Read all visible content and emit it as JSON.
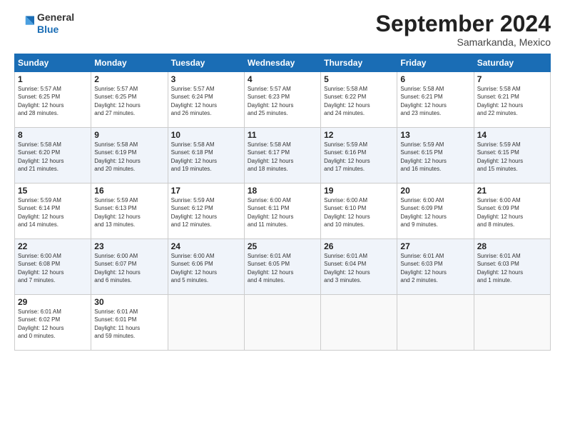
{
  "logo": {
    "line1": "General",
    "line2": "Blue"
  },
  "title": "September 2024",
  "subtitle": "Samarkanda, Mexico",
  "days_header": [
    "Sunday",
    "Monday",
    "Tuesday",
    "Wednesday",
    "Thursday",
    "Friday",
    "Saturday"
  ],
  "weeks": [
    [
      {
        "num": "1",
        "info": "Sunrise: 5:57 AM\nSunset: 6:25 PM\nDaylight: 12 hours\nand 28 minutes."
      },
      {
        "num": "2",
        "info": "Sunrise: 5:57 AM\nSunset: 6:25 PM\nDaylight: 12 hours\nand 27 minutes."
      },
      {
        "num": "3",
        "info": "Sunrise: 5:57 AM\nSunset: 6:24 PM\nDaylight: 12 hours\nand 26 minutes."
      },
      {
        "num": "4",
        "info": "Sunrise: 5:57 AM\nSunset: 6:23 PM\nDaylight: 12 hours\nand 25 minutes."
      },
      {
        "num": "5",
        "info": "Sunrise: 5:58 AM\nSunset: 6:22 PM\nDaylight: 12 hours\nand 24 minutes."
      },
      {
        "num": "6",
        "info": "Sunrise: 5:58 AM\nSunset: 6:21 PM\nDaylight: 12 hours\nand 23 minutes."
      },
      {
        "num": "7",
        "info": "Sunrise: 5:58 AM\nSunset: 6:21 PM\nDaylight: 12 hours\nand 22 minutes."
      }
    ],
    [
      {
        "num": "8",
        "info": "Sunrise: 5:58 AM\nSunset: 6:20 PM\nDaylight: 12 hours\nand 21 minutes."
      },
      {
        "num": "9",
        "info": "Sunrise: 5:58 AM\nSunset: 6:19 PM\nDaylight: 12 hours\nand 20 minutes."
      },
      {
        "num": "10",
        "info": "Sunrise: 5:58 AM\nSunset: 6:18 PM\nDaylight: 12 hours\nand 19 minutes."
      },
      {
        "num": "11",
        "info": "Sunrise: 5:58 AM\nSunset: 6:17 PM\nDaylight: 12 hours\nand 18 minutes."
      },
      {
        "num": "12",
        "info": "Sunrise: 5:59 AM\nSunset: 6:16 PM\nDaylight: 12 hours\nand 17 minutes."
      },
      {
        "num": "13",
        "info": "Sunrise: 5:59 AM\nSunset: 6:15 PM\nDaylight: 12 hours\nand 16 minutes."
      },
      {
        "num": "14",
        "info": "Sunrise: 5:59 AM\nSunset: 6:15 PM\nDaylight: 12 hours\nand 15 minutes."
      }
    ],
    [
      {
        "num": "15",
        "info": "Sunrise: 5:59 AM\nSunset: 6:14 PM\nDaylight: 12 hours\nand 14 minutes."
      },
      {
        "num": "16",
        "info": "Sunrise: 5:59 AM\nSunset: 6:13 PM\nDaylight: 12 hours\nand 13 minutes."
      },
      {
        "num": "17",
        "info": "Sunrise: 5:59 AM\nSunset: 6:12 PM\nDaylight: 12 hours\nand 12 minutes."
      },
      {
        "num": "18",
        "info": "Sunrise: 6:00 AM\nSunset: 6:11 PM\nDaylight: 12 hours\nand 11 minutes."
      },
      {
        "num": "19",
        "info": "Sunrise: 6:00 AM\nSunset: 6:10 PM\nDaylight: 12 hours\nand 10 minutes."
      },
      {
        "num": "20",
        "info": "Sunrise: 6:00 AM\nSunset: 6:09 PM\nDaylight: 12 hours\nand 9 minutes."
      },
      {
        "num": "21",
        "info": "Sunrise: 6:00 AM\nSunset: 6:09 PM\nDaylight: 12 hours\nand 8 minutes."
      }
    ],
    [
      {
        "num": "22",
        "info": "Sunrise: 6:00 AM\nSunset: 6:08 PM\nDaylight: 12 hours\nand 7 minutes."
      },
      {
        "num": "23",
        "info": "Sunrise: 6:00 AM\nSunset: 6:07 PM\nDaylight: 12 hours\nand 6 minutes."
      },
      {
        "num": "24",
        "info": "Sunrise: 6:00 AM\nSunset: 6:06 PM\nDaylight: 12 hours\nand 5 minutes."
      },
      {
        "num": "25",
        "info": "Sunrise: 6:01 AM\nSunset: 6:05 PM\nDaylight: 12 hours\nand 4 minutes."
      },
      {
        "num": "26",
        "info": "Sunrise: 6:01 AM\nSunset: 6:04 PM\nDaylight: 12 hours\nand 3 minutes."
      },
      {
        "num": "27",
        "info": "Sunrise: 6:01 AM\nSunset: 6:03 PM\nDaylight: 12 hours\nand 2 minutes."
      },
      {
        "num": "28",
        "info": "Sunrise: 6:01 AM\nSunset: 6:03 PM\nDaylight: 12 hours\nand 1 minute."
      }
    ],
    [
      {
        "num": "29",
        "info": "Sunrise: 6:01 AM\nSunset: 6:02 PM\nDaylight: 12 hours\nand 0 minutes."
      },
      {
        "num": "30",
        "info": "Sunrise: 6:01 AM\nSunset: 6:01 PM\nDaylight: 11 hours\nand 59 minutes."
      },
      {
        "num": "",
        "info": ""
      },
      {
        "num": "",
        "info": ""
      },
      {
        "num": "",
        "info": ""
      },
      {
        "num": "",
        "info": ""
      },
      {
        "num": "",
        "info": ""
      }
    ]
  ]
}
